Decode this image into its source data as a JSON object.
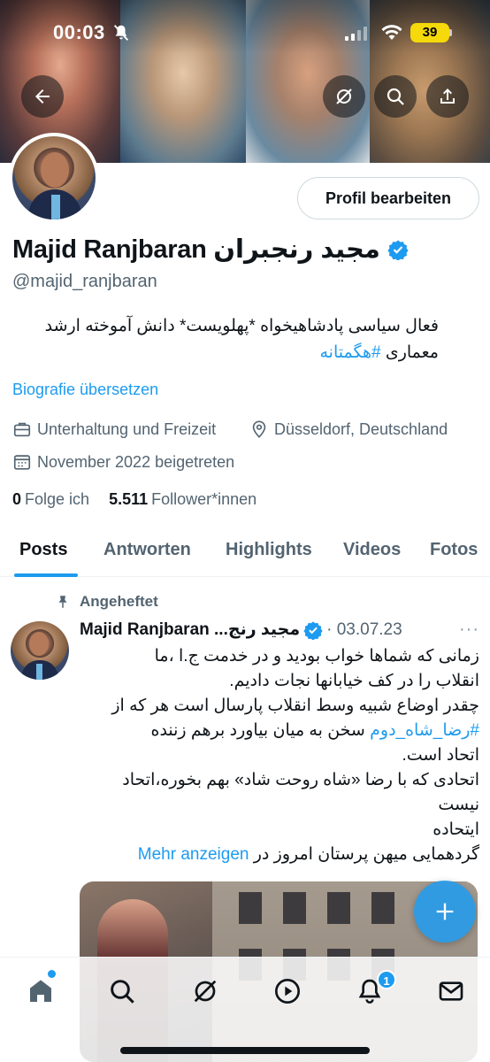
{
  "status_bar": {
    "time": "00:03",
    "battery": "39",
    "icons": [
      "bell-slash-icon",
      "signal-icon",
      "wifi-icon",
      "battery-icon"
    ]
  },
  "header_actions": {
    "back_icon": "arrow-left-icon",
    "grok_icon": "grok-icon",
    "search_icon": "search-icon",
    "share_icon": "share-icon"
  },
  "profile": {
    "edit_label": "Profil bearbeiten",
    "display_name": "Majid Ranjbaran مجید رنجبران",
    "handle": "@majid_ranjbaran",
    "bio_text": "فعال سیاسی پادشاهیخواه *پهلویست* دانش آموخته ارشد معماری ",
    "bio_hashtag": "#هگمتانه",
    "translate_label": "Biografie übersetzen",
    "category": "Unterhaltung und Freizeit",
    "location": "Düsseldorf, Deutschland",
    "joined": "November 2022 beigetreten",
    "following_count": "0",
    "following_label": "Folge ich",
    "followers_count": "5.511",
    "followers_label": "Follower*innen"
  },
  "tabs": [
    {
      "label": "Posts",
      "active": true
    },
    {
      "label": "Antworten",
      "active": false
    },
    {
      "label": "Highlights",
      "active": false
    },
    {
      "label": "Videos",
      "active": false
    },
    {
      "label": "Fotos",
      "active": false
    }
  ],
  "pinned_tweet": {
    "pinned_label": "Angeheftet",
    "author_name": "Majid Ranjbaran ...مجید رنج",
    "date": "· 03.07.23",
    "more_label": "···",
    "line1": "زمانی که شماها خواب بودید و در خدمت ج.ا ،ما",
    "line2": "انقلاب را در کف خیابانها نجات دادیم.",
    "line3": "چقدر اوضاع شبیه وسط انقلاب پارسال است هر که از",
    "line4_link": "#رضا_شاه_دوم",
    "line4_text": " سخن به میان بیاورد برهم زننده",
    "line5": "اتحاد است.",
    "line6": "اتحادی که با رضا «شاه روحت شاد» بهم بخوره،اتحاد",
    "line7": "نیست",
    "line8": "ایتحاده",
    "line9": "گردهمایی میهن پرستان امروز در ",
    "show_more": "Mehr anzeigen"
  },
  "bottom_nav": {
    "items": [
      "home-icon",
      "search-icon",
      "grok-icon",
      "video-icon",
      "bell-icon",
      "mail-icon"
    ],
    "notification_count": "1"
  },
  "colors": {
    "accent": "#1d9bf0",
    "text_primary": "#0f1419",
    "text_secondary": "#536471"
  }
}
